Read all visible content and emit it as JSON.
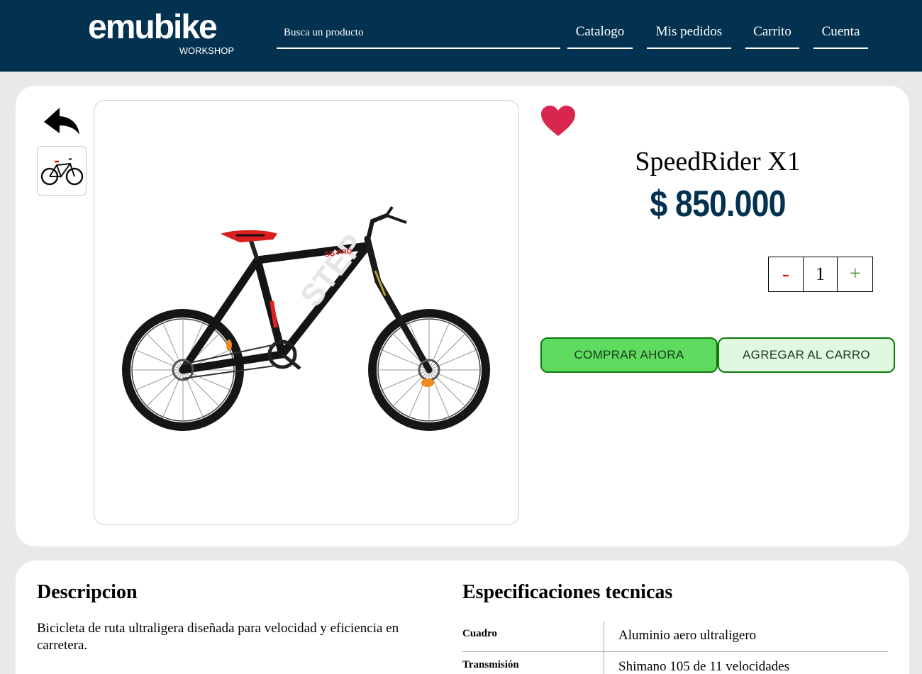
{
  "header": {
    "logo_text": "emubike",
    "logo_subtext": "WORKSHOP",
    "search_placeholder": "Busca un producto",
    "nav": [
      "Catalogo",
      "Mis pedidos",
      "Carrito",
      "Cuenta"
    ]
  },
  "product": {
    "name": "SpeedRider X1",
    "price": "$ 850.000",
    "quantity": "1",
    "qty_minus": "-",
    "qty_plus": "+",
    "buy_label": "COMPRAR AHORA",
    "cart_label": "AGREGAR AL CARRO",
    "bike_frame_text": "STEP",
    "bike_model_text": "SG PRO"
  },
  "details": {
    "description_title": "Descripcion",
    "description_text": "Bicicleta de ruta ultraligera diseñada para velocidad y eficiencia en carretera.",
    "specs_title": "Especificaciones tecnicas",
    "specs": [
      {
        "key": "Cuadro",
        "value": "Aluminio aero ultraligero"
      },
      {
        "key": "Transmisión",
        "value": "Shimano 105 de 11 velocidades"
      }
    ]
  },
  "colors": {
    "header_bg": "#033150",
    "price": "#033150",
    "heart": "#d9264f",
    "buy_button": "#5fdc5f",
    "cart_button": "#dff8df",
    "button_border": "#0a7a0a"
  },
  "icons": [
    "back-arrow-icon",
    "heart-icon",
    "bike-logo"
  ]
}
